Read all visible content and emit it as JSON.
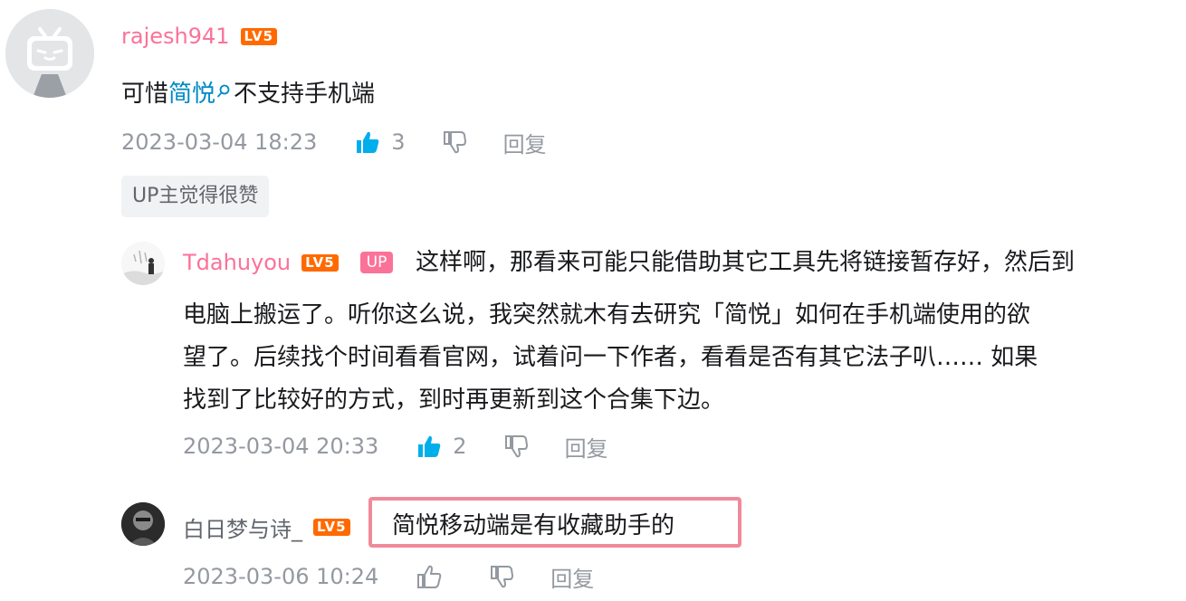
{
  "comments": [
    {
      "username": "rajesh941",
      "level": "LV5",
      "content_before": "可惜",
      "content_link": "简悦",
      "content_after": "不支持手机端",
      "time": "2023-03-04 18:23",
      "likes": "3",
      "reply_label": "回复",
      "tag": "UP主觉得很赞"
    }
  ],
  "replies": [
    {
      "username": "Tdahuyou",
      "level": "LV5",
      "up_badge": "UP",
      "line1": "这样啊，那看来可能只能借助其它工具先将链接暂存好，然后到",
      "line2": "电脑上搬运了。听你这么说，我突然就木有去研究「简悦」如何在手机端使用的欲",
      "line3": "望了。后续找个时间看看官网，试着问一下作者，看看是否有其它法子叭…… 如果",
      "line4": "找到了比较好的方式，到时再更新到这个合集下边。",
      "time": "2023-03-04 20:33",
      "likes": "2",
      "reply_label": "回复"
    },
    {
      "username": "白日梦与诗_",
      "level": "LV5",
      "content": "简悦移动端是有收藏助手的",
      "time": "2023-03-06 10:24",
      "reply_label": "回复"
    }
  ],
  "colors": {
    "username_pink": "#fb7299",
    "link_blue": "#008ac5",
    "level_orange": "#ff6a00",
    "like_active": "#00aeec",
    "meta_gray": "#9499a0",
    "highlight_border": "#f08a9a"
  }
}
